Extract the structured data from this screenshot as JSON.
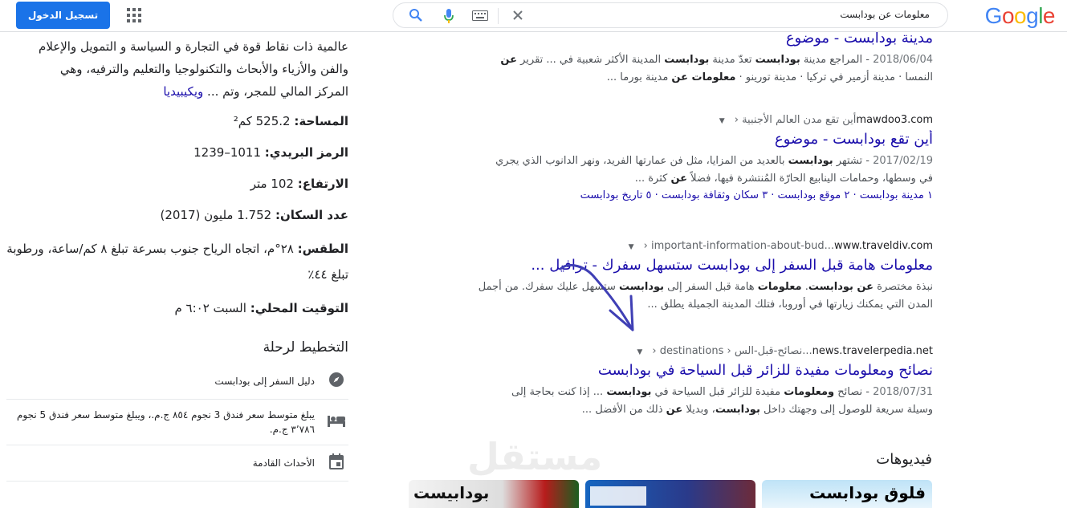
{
  "header": {
    "logo_letters": [
      "G",
      "o",
      "o",
      "g",
      "l",
      "e"
    ],
    "search_query": "معلومات عن بودابست",
    "signin_label": "تسجيل الدخول"
  },
  "results": [
    {
      "title": "مدينة بودابست - موضوع",
      "date": "2018/06/04",
      "snippet_line1_parts": [
        " - المراجع مدينة ",
        "بودابست",
        " تعدّ مدينة ",
        "بودابست",
        " المدينة الأكثر شعبية في ... تقرير ",
        "عن"
      ],
      "snippet_line2_parts": [
        "النمسا · مدينة أزمير في تركيا · مدينة تورينو · ",
        "معلومات عن",
        " مدينة بورما ..."
      ]
    },
    {
      "cite_domain": "mawdoo3.com",
      "cite_path": " › أين تقع مدن العالم الأجنبية",
      "title": "أين تقع بودابست - موضوع",
      "date": "2017/02/19",
      "snippet_line1_parts": [
        " - تشتهر ",
        "بودابست",
        " بالعديد من المزايا، مثل فن عمارتها الفريد، ونهر الدانوب الذي يجري"
      ],
      "snippet_line2_parts": [
        "في وسطها، وحمامات الينابيع الحارّة المُنتشرة فيها، فضلاً ",
        "عن",
        " كثرة ..."
      ],
      "sitelinks": "١ مدينة بودابست · ٢ موقع بودابست · ٣ سكان وثقافة بودابست · ٥ تاريخ بودابست"
    },
    {
      "cite_domain": "www.traveldiv.com",
      "cite_path": " › important-information-about-bud...",
      "title": "معلومات هامة قبل السفر إلى بودابست ستسهل سفرك - ترافيل ...",
      "snippet_line1_parts": [
        "نبذة مختصرة ",
        "عن بودابست",
        ". ",
        "معلومات",
        " هامة قبل السفر إلى ",
        "بودابست",
        " ستسهل عليك سفرك. من أجمل"
      ],
      "snippet_line2_parts": [
        "المدن التي يمكنك زيارتها في أوروبا، فتلك المدينة الجميلة يطلق ..."
      ]
    },
    {
      "cite_domain": "news.travelerpedia.net",
      "cite_path": " › destinations › نصائح-قبل-الس...",
      "title": "نصائح ومعلومات مفيدة للزائر قبل السياحة في بودابست",
      "date": "2018/07/31",
      "snippet_line1_parts": [
        " - نصائح ",
        "ومعلومات",
        " مفيدة للزائر قبل السياحة في ",
        "بودابست",
        " ... إذا كنت بحاجة إلى"
      ],
      "snippet_line2_parts": [
        "وسيلة سريعة للوصول إلى وجهتك داخل ",
        "بودابست",
        "، وبديلا ",
        "عن",
        " ذلك من الأفضل ..."
      ]
    }
  ],
  "knowledge_panel": {
    "desc_line1": "عالمية ذات نقاط قوة في التجارة و السياسة و التمويل والإعلام",
    "desc_line2": "والفن والأزياء والأبحاث والتكنولوجيا والتعليم والترفيه، وهي",
    "desc_line3": "المركز المالي للمجر، وتم ...",
    "desc_source": "ويكيبيديا",
    "facts": [
      {
        "label": "المساحة:",
        "value": " 525.2 كم²"
      },
      {
        "label": "الرمز البريدي:",
        "value": " 1011–1239"
      },
      {
        "label": "الارتفاع:",
        "value": " 102 متر"
      },
      {
        "label": "عدد السكان:",
        "value": " 1.752 مليون (2017)"
      },
      {
        "label": "الطقس:",
        "value": " ٢٨°م، اتجاه الرياح جنوب بسرعة تبلغ ٨ كم/ساعة، ورطوبة تبلغ ٤٤٪"
      },
      {
        "label": "التوقيت المحلي:",
        "value": " السبت ٦:٠٢ م"
      }
    ],
    "plan_title": "التخطيط لرحلة",
    "plan_items": [
      {
        "icon": "compass-icon",
        "label": "دليل السفر إلى بودابست"
      },
      {
        "icon": "bed-icon",
        "label": "يبلغ متوسط سعر فندق 3 نجوم ٨٥٤ ج.م.، ويبلغ متوسط سعر فندق 5 نجوم ٣٬٧٨٦ ج.م."
      },
      {
        "icon": "calendar-icon",
        "label": "الأحداث القادمة"
      }
    ]
  },
  "videos": {
    "heading": "فيديوهات",
    "thumbs": [
      {
        "caption": "فلوق بودابست"
      },
      {
        "caption": ""
      },
      {
        "caption": "بودابيست"
      }
    ]
  },
  "watermark": "مستقل",
  "colors": {
    "link": "#1a0dab",
    "signin_bg": "#1a73e8",
    "arrow": "#3f3fb5"
  }
}
